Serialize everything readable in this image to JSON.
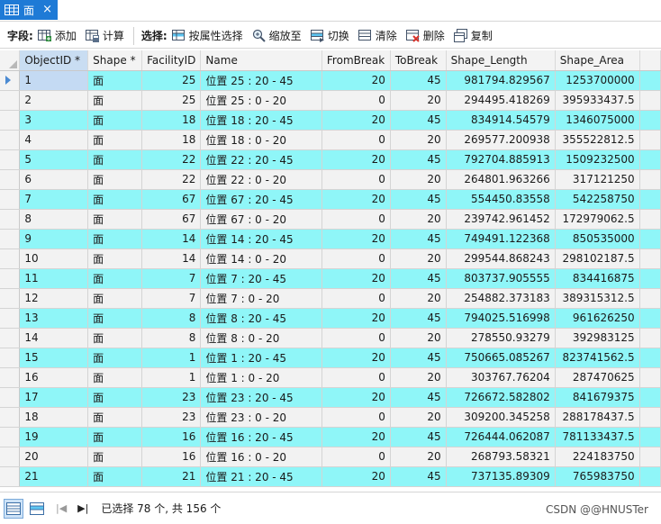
{
  "tab": {
    "title": "面",
    "close": "×"
  },
  "toolbar": {
    "field_label": "字段:",
    "add": "添加",
    "calculate": "计算",
    "select_label": "选择:",
    "select_by_attr": "按属性选择",
    "zoom_to": "缩放至",
    "switch": "切换",
    "clear": "清除",
    "delete": "删除",
    "copy": "复制"
  },
  "table": {
    "columns": [
      "ObjectID *",
      "Shape *",
      "FacilityID",
      "Name",
      "FromBreak",
      "ToBreak",
      "Shape_Length",
      "Shape_Area"
    ],
    "rows": [
      [
        "1",
        "面",
        "25",
        "位置 25 : 20 - 45",
        "20",
        "45",
        "981794.829567",
        "1253700000"
      ],
      [
        "2",
        "面",
        "25",
        "位置 25 : 0 - 20",
        "0",
        "20",
        "294495.418269",
        "395933437.5"
      ],
      [
        "3",
        "面",
        "18",
        "位置 18 : 20 - 45",
        "20",
        "45",
        "834914.54579",
        "1346075000"
      ],
      [
        "4",
        "面",
        "18",
        "位置 18 : 0 - 20",
        "0",
        "20",
        "269577.200938",
        "355522812.5"
      ],
      [
        "5",
        "面",
        "22",
        "位置 22 : 20 - 45",
        "20",
        "45",
        "792704.885913",
        "1509232500"
      ],
      [
        "6",
        "面",
        "22",
        "位置 22 : 0 - 20",
        "0",
        "20",
        "264801.963266",
        "317121250"
      ],
      [
        "7",
        "面",
        "67",
        "位置 67 : 20 - 45",
        "20",
        "45",
        "554450.83558",
        "542258750"
      ],
      [
        "8",
        "面",
        "67",
        "位置 67 : 0 - 20",
        "0",
        "20",
        "239742.961452",
        "172979062.5"
      ],
      [
        "9",
        "面",
        "14",
        "位置 14 : 20 - 45",
        "20",
        "45",
        "749491.122368",
        "850535000"
      ],
      [
        "10",
        "面",
        "14",
        "位置 14 : 0 - 20",
        "0",
        "20",
        "299544.868243",
        "298102187.5"
      ],
      [
        "11",
        "面",
        "7",
        "位置 7 : 20 - 45",
        "20",
        "45",
        "803737.905555",
        "834416875"
      ],
      [
        "12",
        "面",
        "7",
        "位置 7 : 0 - 20",
        "0",
        "20",
        "254882.373183",
        "389315312.5"
      ],
      [
        "13",
        "面",
        "8",
        "位置 8 : 20 - 45",
        "20",
        "45",
        "794025.516998",
        "961626250"
      ],
      [
        "14",
        "面",
        "8",
        "位置 8 : 0 - 20",
        "0",
        "20",
        "278550.93279",
        "392983125"
      ],
      [
        "15",
        "面",
        "1",
        "位置 1 : 20 - 45",
        "20",
        "45",
        "750665.085267",
        "823741562.5"
      ],
      [
        "16",
        "面",
        "1",
        "位置 1 : 0 - 20",
        "0",
        "20",
        "303767.76204",
        "287470625"
      ],
      [
        "17",
        "面",
        "23",
        "位置 23 : 20 - 45",
        "20",
        "45",
        "726672.582802",
        "841679375"
      ],
      [
        "18",
        "面",
        "23",
        "位置 23 : 0 - 20",
        "0",
        "20",
        "309200.345258",
        "288178437.5"
      ],
      [
        "19",
        "面",
        "16",
        "位置 16 : 20 - 45",
        "20",
        "45",
        "726444.062087",
        "781133437.5"
      ],
      [
        "20",
        "面",
        "16",
        "位置 16 : 0 - 20",
        "0",
        "20",
        "268793.58321",
        "224183750"
      ],
      [
        "21",
        "面",
        "21",
        "位置 21 : 20 - 45",
        "20",
        "45",
        "737135.89309",
        "765983750"
      ]
    ]
  },
  "status": {
    "selection": "已选择 78 个, 共 156 个"
  },
  "watermark": "CSDN @@HNUSTer",
  "colors": {
    "highlight_row": "#8ff6f8",
    "plain_row": "#f2f2f2",
    "tab_accent": "#1e7ad6"
  }
}
